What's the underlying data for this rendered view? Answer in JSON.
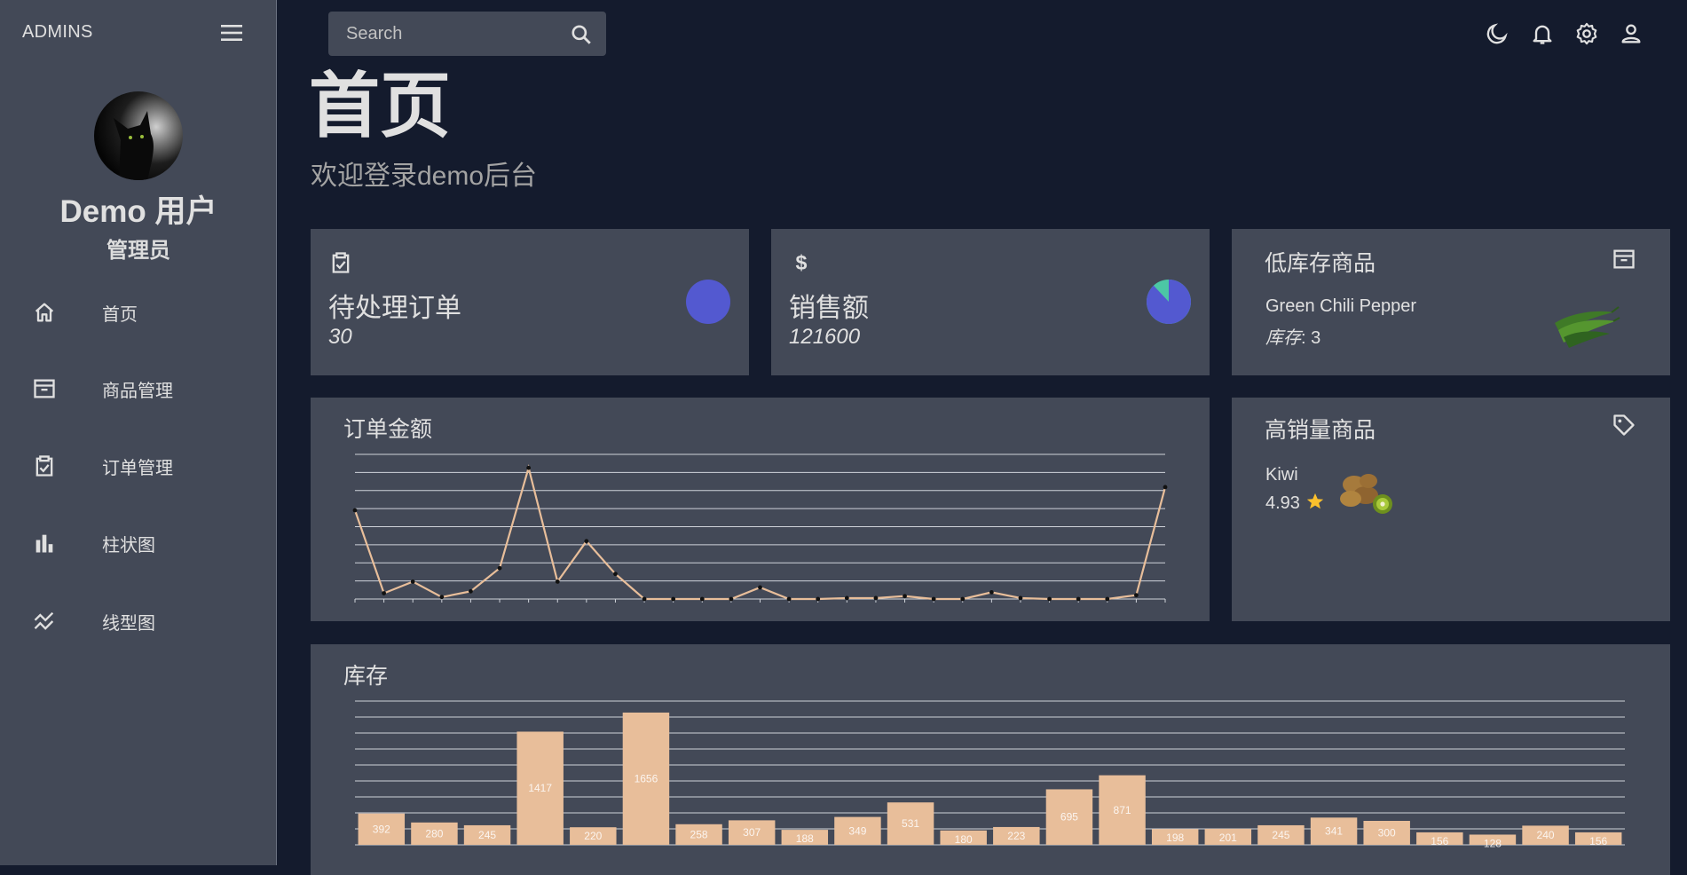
{
  "sidebar": {
    "brand": "ADMINS",
    "user_name": "Demo 用户",
    "user_role": "管理员",
    "items": [
      {
        "label": "首页",
        "icon": "home-icon"
      },
      {
        "label": "商品管理",
        "icon": "archive-icon"
      },
      {
        "label": "订单管理",
        "icon": "clipboard-check-icon"
      },
      {
        "label": "柱状图",
        "icon": "bar-chart-icon"
      },
      {
        "label": "线型图",
        "icon": "line-chart-icon"
      }
    ]
  },
  "topbar": {
    "search_placeholder": "Search",
    "icons": [
      "moon-icon",
      "bell-icon",
      "gear-icon",
      "user-icon"
    ]
  },
  "header": {
    "title": "首页",
    "subtitle": "欢迎登录demo后台"
  },
  "stats": [
    {
      "label": "待处理订单",
      "value": "30",
      "icon": "clipboard-check-icon",
      "pie_fraction": 1.0
    },
    {
      "label": "销售额",
      "value": "121600",
      "icon": "dollar-icon",
      "pie_fraction": 0.88
    }
  ],
  "low_stock": {
    "title": "低库存商品",
    "product_name": "Green Chili Pepper",
    "stock_label": "库存",
    "stock_value": ": 3",
    "icon": "archive-icon"
  },
  "top_selling": {
    "title": "高销量商品",
    "product_name": "Kiwi",
    "rating": "4.93",
    "icon": "tag-icon"
  },
  "colors": {
    "bg": "#141b2d",
    "panel": "#434957",
    "accent": "#e8be9a",
    "pie_main": "#5359d0",
    "pie_secondary": "#4cc7a5",
    "star": "#fbc02d"
  },
  "chart_data": [
    {
      "type": "line",
      "title": "订单金额",
      "values": [
        4600,
        300,
        900,
        100,
        400,
        1600,
        6800,
        900,
        3000,
        1300,
        0,
        0,
        0,
        0,
        600,
        0,
        0,
        50,
        50,
        150,
        0,
        0,
        350,
        50,
        0,
        0,
        0,
        200,
        5800
      ],
      "ylim": [
        0,
        7500
      ],
      "grid": true
    },
    {
      "type": "bar",
      "title": "库存",
      "values": [
        392,
        280,
        245,
        1417,
        220,
        1656,
        258,
        307,
        188,
        349,
        531,
        180,
        223,
        695,
        871,
        198,
        201,
        245,
        341,
        300,
        156,
        128,
        240,
        156
      ],
      "ylim": [
        0,
        1800
      ],
      "grid": true
    }
  ]
}
